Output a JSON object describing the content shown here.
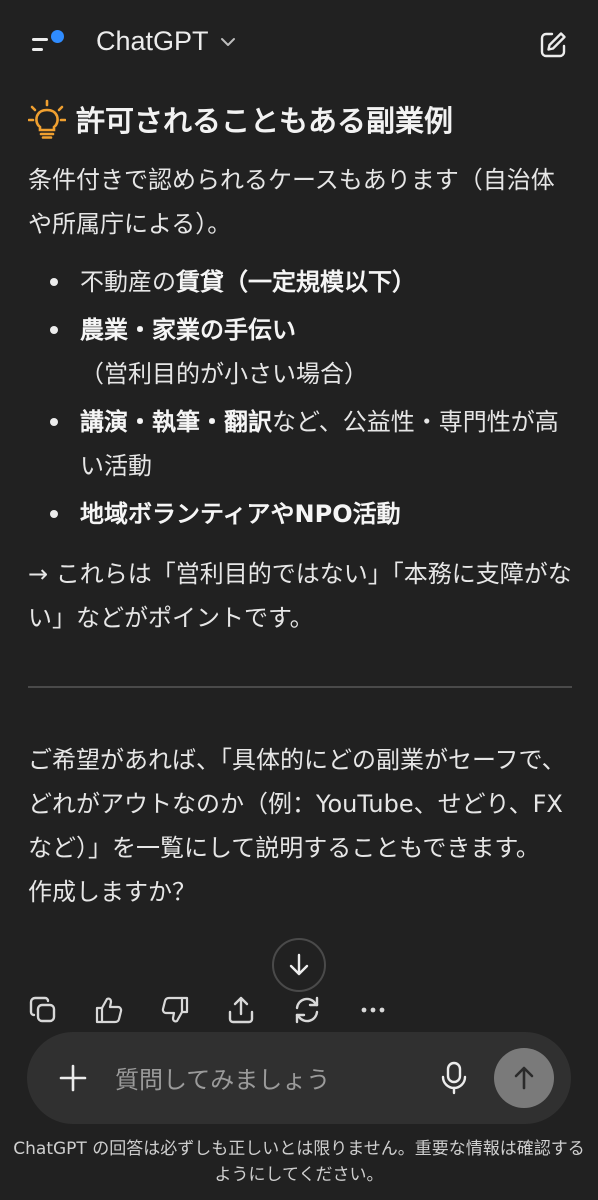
{
  "header": {
    "title": "ChatGPT",
    "menu_icon": "menu-icon",
    "new_chat_icon": "edit-icon"
  },
  "message": {
    "heading_icon": "lightbulb-icon",
    "heading": "許可されることもある副業例",
    "intro": "条件付きで認められるケースもあります（自治体や所属庁による）。",
    "bullets": [
      {
        "normal_before": "不動産の",
        "bold": "賃貸（一定規模以下）",
        "normal_after": ""
      },
      {
        "normal_before": "",
        "bold": "農業・家業の手伝い",
        "normal_after": "（営利目的が小さい場合）"
      },
      {
        "normal_before": "",
        "bold": "講演・執筆・翻訳",
        "normal_after": "など、公益性・専門性が高い活動"
      },
      {
        "normal_before": "",
        "bold": "地域ボランティアやNPO活動",
        "normal_after": ""
      }
    ],
    "conclusion": "→ これらは「営利目的ではない」「本務に支障がない」などがポイントです。",
    "offer": "ご希望があれば、「具体的にどの副業がセーフで、どれがアウトなのか（例：YouTube、せどり、FXなど）」を一覧にして説明することもできます。",
    "question": "作成しますか？"
  },
  "actions": [
    "copy-icon",
    "thumbs-up-icon",
    "thumbs-down-icon",
    "share-icon",
    "regenerate-icon",
    "more-icon"
  ],
  "composer": {
    "placeholder": "質問してみましょう"
  },
  "disclaimer": "ChatGPT の回答は必ずしも正しいとは限りません。重要な情報は確認するようにしてください。",
  "colors": {
    "background": "#212121",
    "composer": "#303030",
    "accent_dot": "#2f8cff",
    "bulb": "#f0a030"
  }
}
